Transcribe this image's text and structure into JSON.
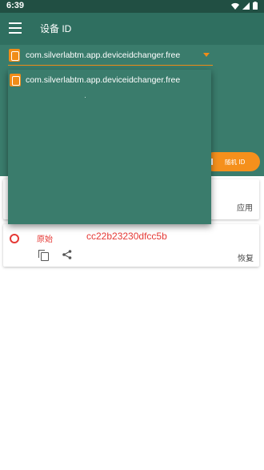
{
  "status_bar": {
    "time": "6:39",
    "icons": [
      "wifi-icon",
      "signal-icon",
      "battery-icon"
    ]
  },
  "toolbar": {
    "title": "设备 ID",
    "menu_icon": "hamburger-icon"
  },
  "spinner": {
    "selected": "com.silverlabtm.app.deviceidchanger.free",
    "icon": "phone-icon"
  },
  "dropdown": {
    "items": [
      {
        "label": "com.silverlabtm.app.deviceidchanger.free",
        "icon": "phone-icon"
      }
    ]
  },
  "random_button": {
    "label": "随机 ID"
  },
  "new_id_card": {
    "apply_label": "应用"
  },
  "original_card": {
    "label": "原始",
    "value": "cc22b23230dfcc5b",
    "restore_label": "恢复"
  },
  "colors": {
    "primary_dark": "#214f43",
    "primary": "#2f6f60",
    "accent": "#f5901c",
    "original_red": "#e53935"
  }
}
